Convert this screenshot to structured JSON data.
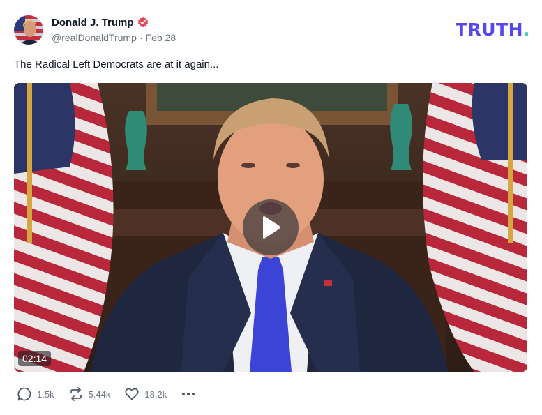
{
  "post": {
    "author": {
      "display_name": "Donald J. Trump",
      "handle": "@realDonaldTrump",
      "separator": "·",
      "date": "Feb 28",
      "verified_icon": "verified-badge-icon"
    },
    "brand": {
      "text": "TRUTH",
      "dot": "."
    },
    "text": "The Radical Left Democrats are at it again...",
    "video": {
      "duration": "02:14",
      "play_icon": "play-icon"
    },
    "actions": {
      "replies": "1.5k",
      "retruths": "5.44k",
      "likes": "18.2k",
      "more_icon": "more-icon"
    }
  },
  "colors": {
    "brand_purple": "#5448ee",
    "brand_teal": "#49c9b4",
    "verified_red": "#e8485a",
    "muted_text": "#6b7280",
    "tie_blue": "#3b44d6"
  }
}
